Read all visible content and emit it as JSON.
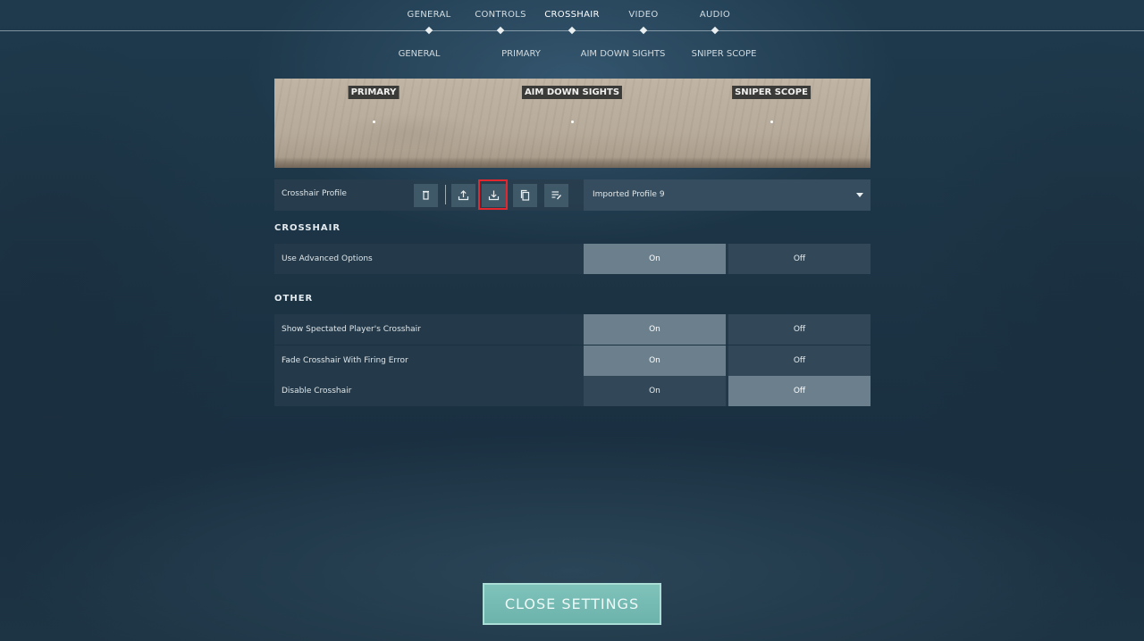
{
  "top_nav": {
    "tabs": [
      {
        "label": "GENERAL",
        "active": false
      },
      {
        "label": "CONTROLS",
        "active": false
      },
      {
        "label": "CROSSHAIR",
        "active": true
      },
      {
        "label": "VIDEO",
        "active": false
      },
      {
        "label": "AUDIO",
        "active": false
      }
    ]
  },
  "sub_nav": {
    "tabs": [
      "GENERAL",
      "PRIMARY",
      "AIM DOWN SIGHTS",
      "SNIPER SCOPE"
    ]
  },
  "preview": {
    "labels": [
      "PRIMARY",
      "AIM DOWN SIGHTS",
      "SNIPER SCOPE"
    ]
  },
  "profile": {
    "label": "Crosshair Profile",
    "buttons": [
      "trash-icon",
      "export-icon",
      "import-icon",
      "copy-icon",
      "rename-icon"
    ],
    "highlighted_button": "import-icon",
    "selected": "Imported Profile 9"
  },
  "sections": {
    "crosshair": {
      "title": "CROSSHAIR",
      "rows": [
        {
          "label": "Use Advanced Options",
          "on": "On",
          "off": "Off",
          "value": "On"
        }
      ]
    },
    "other": {
      "title": "OTHER",
      "rows": [
        {
          "label": "Show Spectated Player's Crosshair",
          "on": "On",
          "off": "Off",
          "value": "On"
        },
        {
          "label": "Fade Crosshair With Firing Error",
          "on": "On",
          "off": "Off",
          "value": "On"
        },
        {
          "label": "Disable Crosshair",
          "on": "On",
          "off": "Off",
          "value": "Off"
        }
      ]
    }
  },
  "close_button": "CLOSE SETTINGS",
  "colors": {
    "accent": "#6cb3ab",
    "highlight": "#e2282e"
  }
}
